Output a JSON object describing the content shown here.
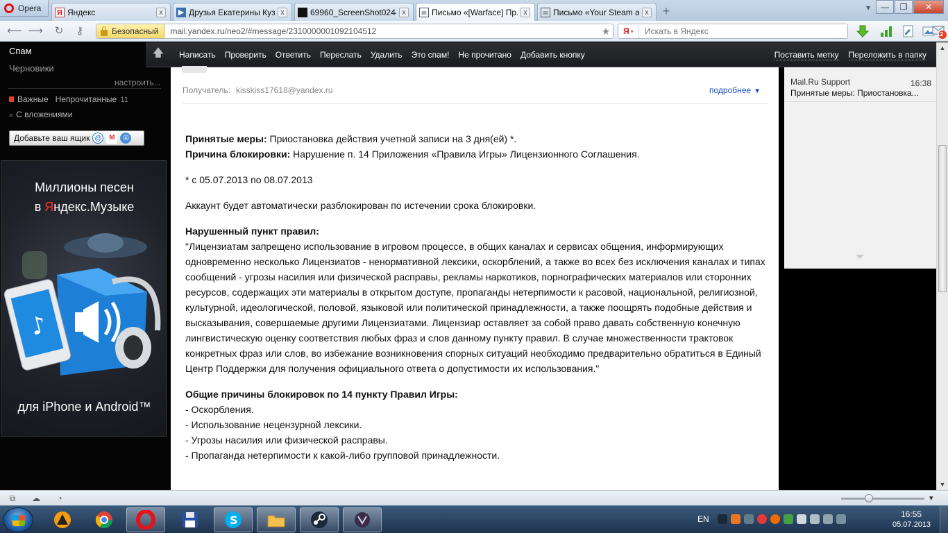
{
  "browser": {
    "menu_label": "Opera",
    "tabs": [
      {
        "title": "Яндекс",
        "icon": "yandex-icon",
        "active": false
      },
      {
        "title": "Друзья Екатерины Куз...",
        "icon": "play-icon",
        "active": false
      },
      {
        "title": "69960_ScreenShot0244....",
        "icon": "image-icon",
        "active": false
      },
      {
        "title": "Письмо «[Warface] Пр...",
        "icon": "mail-icon",
        "active": true
      },
      {
        "title": "Письмо «Your Steam a...",
        "icon": "mail-icon",
        "active": false
      }
    ],
    "close_glyph": "x",
    "new_tab_glyph": "+",
    "security_label": "Безопасный",
    "url": "mail.yandex.ru/neo2/#message/2310000001092104512",
    "search_engine_badge": "Я",
    "search_placeholder": "Искать в Яндекс",
    "mail_badge_count": "12",
    "colors": {
      "accent": "#e8141b",
      "link": "#1a4fc4",
      "toolbar": "#1f2023"
    }
  },
  "sidebar": {
    "spam": "Спам",
    "drafts": "Черновики",
    "configure": "настроить...",
    "important": "Важные",
    "unread": "Непрочитанные",
    "unread_count": "11",
    "with_attachments": "С вложениями",
    "add_mailbox": "Добавьте ваш ящик",
    "ad": {
      "line1": "Миллионы песен",
      "line2_prefix": "в ",
      "line2_brand_first": "Я",
      "line2_brand_rest": "ндекс",
      "line2_suffix": ".Музыке",
      "bottom": "для iPhone и Android™"
    }
  },
  "toolbar": {
    "actions": [
      "Написать",
      "Проверить",
      "Ответить",
      "Переслать",
      "Удалить",
      "Это спам!",
      "Не прочитано",
      "Добавить кнопку"
    ],
    "set_label": "Поставить метку",
    "move_to_folder": "Переложить в папку"
  },
  "message": {
    "recipient_label": "Получатель:",
    "recipient": "kisskiss17618@yandex.ru",
    "details": "подробнее",
    "measures_label": "Принятые меры:",
    "measures_text": " Приостановка действия учетной записи на 3 дня(ей) *.",
    "reason_label": "Причина блокировки:",
    "reason_text": " Нарушение п. 14 Приложения «Правила Игры» Лицензионного Соглашения.",
    "period": "* с 05.07.2013 по 08.07.2013",
    "auto_unlock": "Аккаунт будет автоматически разблокирован по истечении срока блокировки.",
    "violated_rule_label": "Нарушенный пункт правил:",
    "violated_rule_text": "\"Лицензиатам запрещено использование в игровом процессе, в общих каналах и сервисах общения, информирующих одновременно несколько Лицензиатов - ненормативной лексики, оскорблений, а также во всех без исключения каналах и типах сообщений - угрозы насилия или физической расправы, рекламы наркотиков, порнографических материалов или сторонних ресурсов, содержащих эти материалы в открытом доступе, пропаганды нетерпимости к расовой, национальной, религиозной, культурной, идеологической, половой, языковой или политической принадлежности, а также поощрять подобные действия и высказывания, совершаемые другими Лицензиатами. Лицензиар оставляет за собой право давать собственную конечную лингвистическую оценку соответствия любых фраз и слов данному пункту правил. В случае множественности трактовок конкретных фраз или слов, во избежание возникновения спорных ситуаций необходимо предварительно обратиться в Единый Центр Поддержки для получения официального ответа о допустимости их использования.\"",
    "general_reasons_label": "Общие причины блокировок по 14 пункту Правил Игры:",
    "general_reasons": [
      "- Оскорбления.",
      "- Использование нецензурной лексики.",
      "- Угрозы насилия или физической расправы.",
      "- Пропаганда нетерпимости к какой-либо групповой принадлежности."
    ]
  },
  "message_list": {
    "sender": "Mail.Ru Support",
    "time": "16:38",
    "subject": "Принятые меры: Приостановка..."
  },
  "taskbar": {
    "language": "EN",
    "time": "16:55",
    "date": "05.07.2013"
  }
}
